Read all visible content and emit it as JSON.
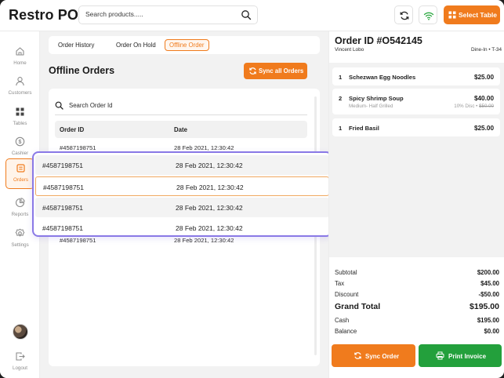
{
  "header": {
    "brand": "Restro POS",
    "search_placeholder": "Search products.....",
    "select_table_label": "Select Table"
  },
  "sidebar": {
    "items": [
      {
        "label": "Home",
        "icon": "home-icon"
      },
      {
        "label": "Customers",
        "icon": "user-icon"
      },
      {
        "label": "Tables",
        "icon": "grid-icon"
      },
      {
        "label": "Cashier",
        "icon": "dollar-icon"
      },
      {
        "label": "Orders",
        "icon": "orders-icon",
        "active": true
      },
      {
        "label": "Reports",
        "icon": "pie-chart-icon"
      },
      {
        "label": "Settings",
        "icon": "settings-icon"
      }
    ],
    "logout_label": "Logout"
  },
  "main": {
    "tabs": [
      {
        "label": "Order History"
      },
      {
        "label": "Order On Hold"
      },
      {
        "label": "Offline Order",
        "active": true
      }
    ],
    "title": "Offline Orders",
    "sync_all_label": "Sync all Orders",
    "search_placeholder": "Search Order Id",
    "columns": [
      "Order ID",
      "Date"
    ],
    "background_rows": [
      {
        "id": "#4587198751",
        "date": "28 Feb 2021, 12:30:42"
      },
      {
        "id": "#4587198751",
        "date": "28 Feb 2021, 12:30:42"
      }
    ],
    "highlight_rows": [
      {
        "id": "#4587198751",
        "date": "28 Feb 2021, 12:30:42"
      },
      {
        "id": "#4587198751",
        "date": "28 Feb 2021, 12:30:42"
      },
      {
        "id": "#4587198751",
        "date": "28 Feb 2021, 12:30:42"
      },
      {
        "id": "#4587198751",
        "date": "28 Feb 2021, 12:30:42"
      }
    ]
  },
  "order": {
    "id": "Order ID #O542145",
    "customer": "Vincent Lobo",
    "meta": "Dine-In • T-34",
    "items": [
      {
        "qty": "1",
        "name": "Schezwan Egg Noodles",
        "price": "$25.00",
        "sub": "",
        "discount": "",
        "old_price": ""
      },
      {
        "qty": "2",
        "name": "Spicy Shrimp Soup",
        "price": "$40.00",
        "sub": "Medium- Half Grilled",
        "discount": "10% Disc •",
        "old_price": "$50.00"
      },
      {
        "qty": "1",
        "name": "Fried Basil",
        "price": "$25.00",
        "sub": "",
        "discount": "",
        "old_price": ""
      }
    ],
    "totals": {
      "subtotal_label": "Subtotal",
      "subtotal": "$200.00",
      "tax_label": "Tax",
      "tax": "$45.00",
      "discount_label": "Discount",
      "discount": "-$50.00",
      "grand_label": "Grand Total",
      "grand": "$195.00",
      "cash_label": "Cash",
      "cash": "$195.00",
      "balance_label": "Balance",
      "balance": "$0.00"
    },
    "sync_order_label": "Sync Order",
    "print_invoice_label": "Print Invoice"
  },
  "colors": {
    "accent": "#f07b1d",
    "success": "#23a03c",
    "highlight_border": "#8a79e6"
  }
}
